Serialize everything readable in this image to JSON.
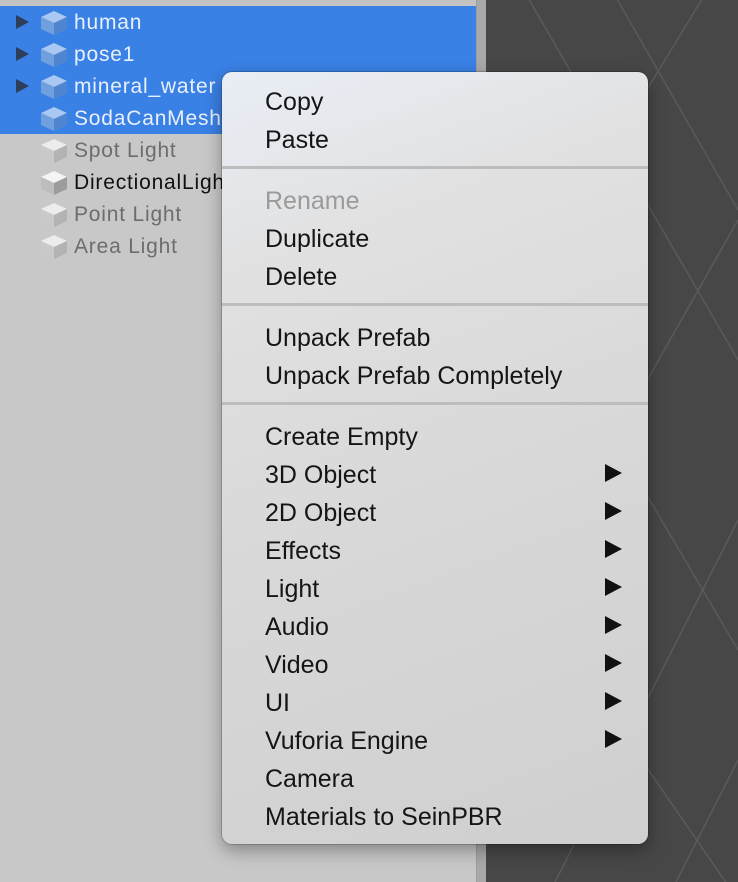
{
  "hierarchy": {
    "items": [
      {
        "label": "human",
        "expandable": true,
        "state": "selected"
      },
      {
        "label": "pose1",
        "expandable": true,
        "state": "selected"
      },
      {
        "label": "mineral_water",
        "expandable": true,
        "state": "selected"
      },
      {
        "label": "SodaCanMesh",
        "expandable": false,
        "state": "selected"
      },
      {
        "label": "Spot Light",
        "expandable": false,
        "state": "dim"
      },
      {
        "label": "DirectionalLight",
        "expandable": false,
        "state": "normal"
      },
      {
        "label": "Point Light",
        "expandable": false,
        "state": "dim"
      },
      {
        "label": "Area Light",
        "expandable": false,
        "state": "dim"
      }
    ]
  },
  "context_menu": {
    "groups": [
      [
        {
          "label": "Copy",
          "enabled": true,
          "submenu": false
        },
        {
          "label": "Paste",
          "enabled": true,
          "submenu": false
        }
      ],
      [
        {
          "label": "Rename",
          "enabled": false,
          "submenu": false
        },
        {
          "label": "Duplicate",
          "enabled": true,
          "submenu": false
        },
        {
          "label": "Delete",
          "enabled": true,
          "submenu": false
        }
      ],
      [
        {
          "label": "Unpack Prefab",
          "enabled": true,
          "submenu": false
        },
        {
          "label": "Unpack Prefab Completely",
          "enabled": true,
          "submenu": false
        }
      ],
      [
        {
          "label": "Create Empty",
          "enabled": true,
          "submenu": false
        },
        {
          "label": "3D Object",
          "enabled": true,
          "submenu": true
        },
        {
          "label": "2D Object",
          "enabled": true,
          "submenu": true
        },
        {
          "label": "Effects",
          "enabled": true,
          "submenu": true
        },
        {
          "label": "Light",
          "enabled": true,
          "submenu": true
        },
        {
          "label": "Audio",
          "enabled": true,
          "submenu": true
        },
        {
          "label": "Video",
          "enabled": true,
          "submenu": true
        },
        {
          "label": "UI",
          "enabled": true,
          "submenu": true
        },
        {
          "label": "Vuforia Engine",
          "enabled": true,
          "submenu": true
        },
        {
          "label": "Camera",
          "enabled": true,
          "submenu": false
        },
        {
          "label": "Materials to SeinPBR",
          "enabled": true,
          "submenu": false
        }
      ]
    ]
  },
  "colors": {
    "selection": "#3a81e6",
    "scene_background": "#474747",
    "menu_text": "#151515",
    "menu_disabled_text": "#9a9a9a"
  },
  "icons": {
    "expand": "triangle-right-icon",
    "gameobject": "cube-icon",
    "submenu": "submenu-arrow-icon"
  }
}
